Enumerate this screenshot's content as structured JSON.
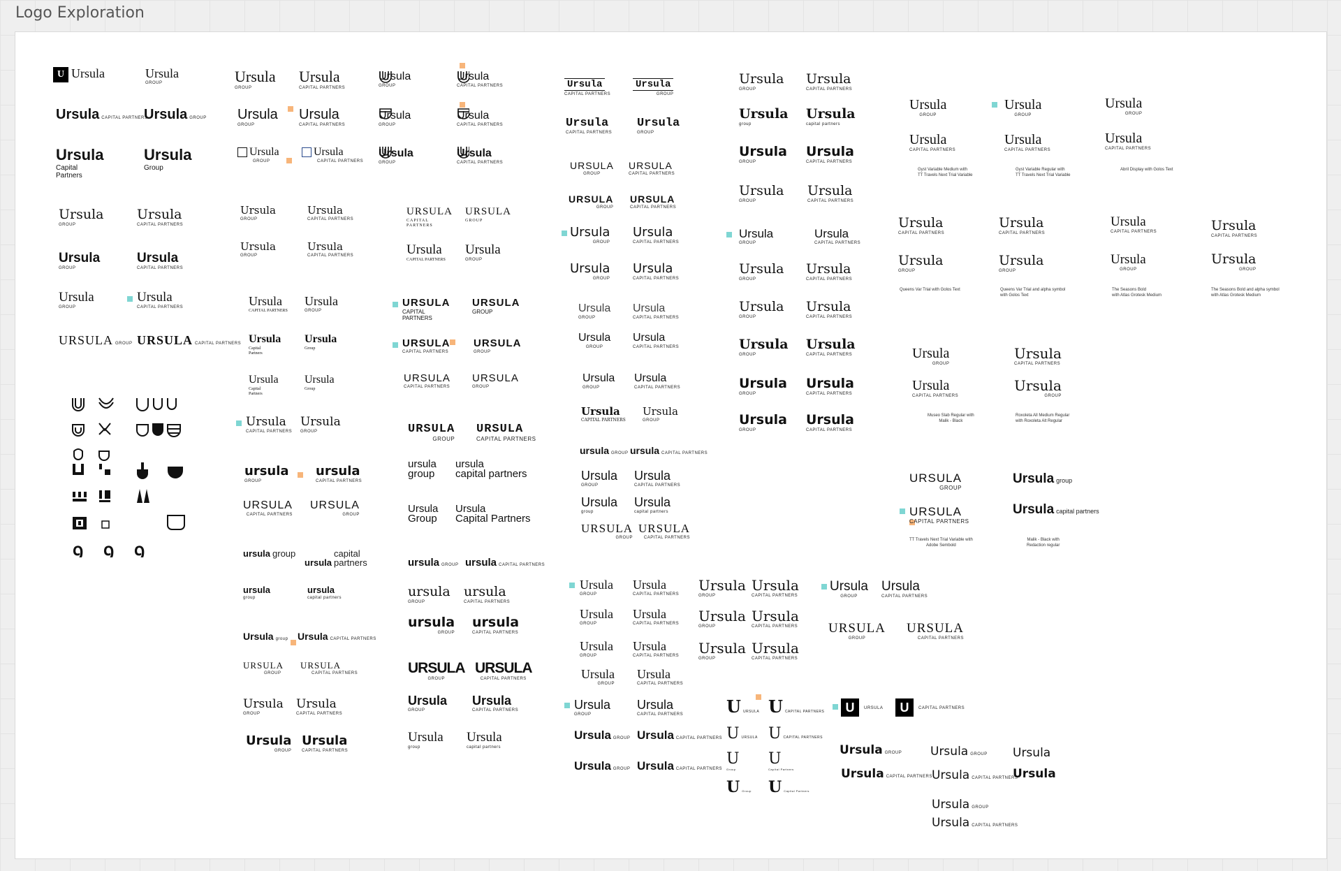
{
  "frame": {
    "title": "Logo Exploration"
  },
  "brand": {
    "name": "Ursula",
    "name_caps": "URSULA",
    "name_lower": "ursula",
    "group": "GROUP",
    "group_tc": "Group",
    "group_lc": "group",
    "cp": "CAPITAL PARTNERS",
    "cp_tc": "Capital Partners",
    "cp_lc": "capital partners",
    "cp_stack": "Capital\nPartners",
    "cp_stack_lc": "capital\npartners"
  },
  "notes": {
    "n1": "Gyst Variable Medium with\nTT Travels Next Trial Variable",
    "n2": "Gyst Variable Regular with\nTT Travels Next Trial Variable",
    "n3": "Abril Display with Golos Text",
    "n4": "Queens Var Trial with Golos Text",
    "n5": "Queens Var Trial and alpha symbol\nwith Golos Text",
    "n6": "The Seasons Bold\nwith Atlas Grotesk Medium",
    "n7": "The Seasons Bold and alpha symbol\nwith Atlas Grotesk Medium",
    "n8": "Museo Slab Regular with\nMalik - Black",
    "n9": "Roxoleta All Medium Regular\nwith Roxoleta Alt Regular",
    "n10": "TT Travels Next Trial Variable with\nAdobe Sembold",
    "n11": "Malik - Black with\nRedaction regular"
  },
  "glyphs": {
    "u_box": "U",
    "u_bracket": "U",
    "u_dots": "U",
    "hook": "ꝯ"
  },
  "colors": {
    "teal": "#7fd6d3",
    "orange": "#f7b57a",
    "ink": "#111111"
  }
}
